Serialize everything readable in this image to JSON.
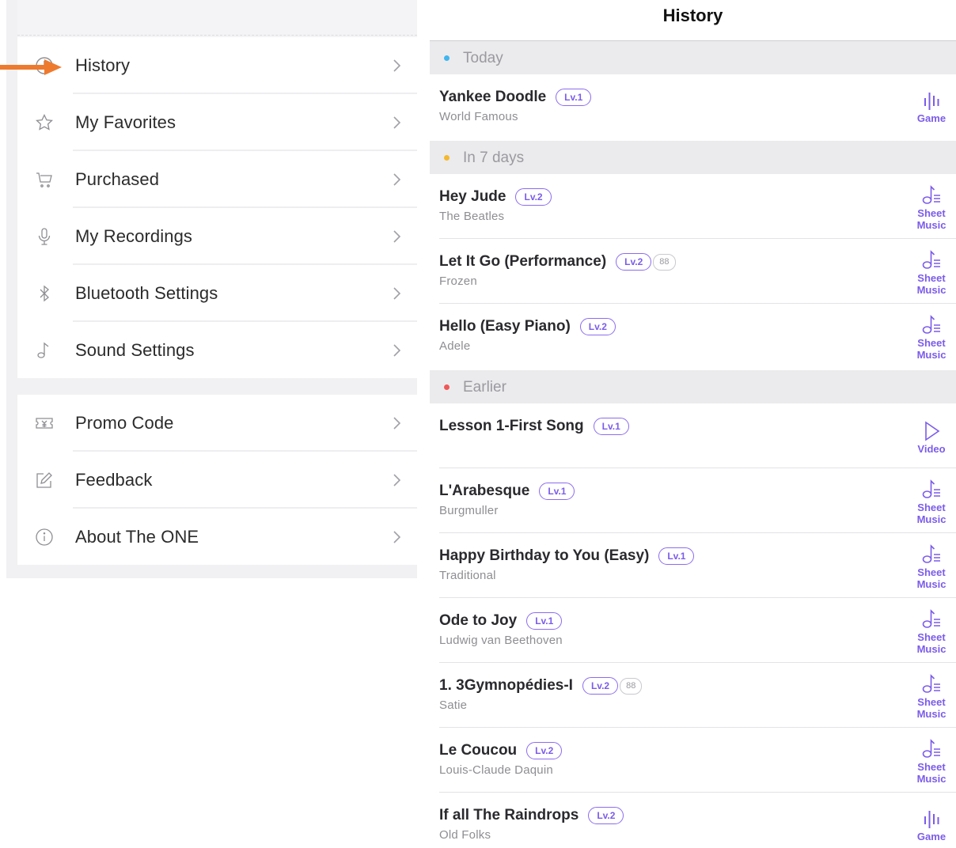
{
  "menu": {
    "group1": [
      {
        "label": "History",
        "icon": "clock-icon"
      },
      {
        "label": "My Favorites",
        "icon": "star-icon"
      },
      {
        "label": "Purchased",
        "icon": "cart-icon"
      },
      {
        "label": "My Recordings",
        "icon": "microphone-icon"
      },
      {
        "label": "Bluetooth Settings",
        "icon": "bluetooth-icon"
      },
      {
        "label": "Sound Settings",
        "icon": "music-note-icon"
      }
    ],
    "group2": [
      {
        "label": "Promo Code",
        "icon": "coupon-icon"
      },
      {
        "label": "Feedback",
        "icon": "edit-icon"
      },
      {
        "label": "About The ONE",
        "icon": "info-icon"
      }
    ],
    "pointer_color": "#ee7a2e"
  },
  "history": {
    "title": "History",
    "sections": [
      {
        "label": "Today",
        "dot_color": "#3fb6ef"
      },
      {
        "label": "In 7 days",
        "dot_color": "#f5b82e"
      },
      {
        "label": "Earlier",
        "dot_color": "#ef5858"
      }
    ],
    "songs": [
      {
        "title": "Yankee Doodle",
        "level": "Lv.1",
        "artist": "World Famous",
        "action": "Game",
        "action_icon": "game-bars-icon"
      },
      {
        "title": "Hey Jude",
        "level": "Lv.2",
        "artist": "The Beatles",
        "action1": "Sheet",
        "action2": "Music",
        "action_icon": "sheet-music-icon"
      },
      {
        "title": "Let It Go (Performance)",
        "level": "Lv.2",
        "extra_badge": "88",
        "artist": "Frozen",
        "action1": "Sheet",
        "action2": "Music",
        "action_icon": "sheet-music-icon"
      },
      {
        "title": "Hello (Easy Piano)",
        "level": "Lv.2",
        "artist": "Adele",
        "action1": "Sheet",
        "action2": "Music",
        "action_icon": "sheet-music-icon"
      },
      {
        "title": "Lesson 1-First Song",
        "level": "Lv.1",
        "artist": "",
        "action": "Video",
        "action_icon": "play-icon"
      },
      {
        "title": "L'Arabesque",
        "level": "Lv.1",
        "artist": "Burgmuller",
        "action1": "Sheet",
        "action2": "Music",
        "action_icon": "sheet-music-icon"
      },
      {
        "title": "Happy Birthday to You (Easy)",
        "level": "Lv.1",
        "artist": "Traditional",
        "action1": "Sheet",
        "action2": "Music",
        "action_icon": "sheet-music-icon"
      },
      {
        "title": "Ode to Joy",
        "level": "Lv.1",
        "artist": "Ludwig van Beethoven",
        "action1": "Sheet",
        "action2": "Music",
        "action_icon": "sheet-music-icon"
      },
      {
        "title": "1. 3Gymnopédies-I",
        "level": "Lv.2",
        "extra_badge": "88",
        "artist": "Satie",
        "action1": "Sheet",
        "action2": "Music",
        "action_icon": "sheet-music-icon"
      },
      {
        "title": "Le Coucou",
        "level": "Lv.2",
        "artist": "Louis-Claude Daquin",
        "action1": "Sheet",
        "action2": "Music",
        "action_icon": "sheet-music-icon"
      },
      {
        "title": "If all The Raindrops",
        "level": "Lv.2",
        "artist": "Old Folks",
        "action": "Game",
        "action_icon": "game-bars-icon"
      }
    ],
    "accent_color": "#7b5cea"
  }
}
